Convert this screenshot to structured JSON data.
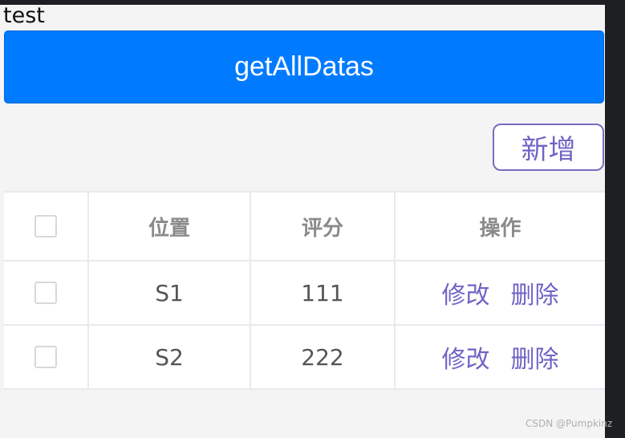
{
  "app": {
    "title": "test",
    "main_button_label": "getAllDatas",
    "add_button_label": "新增"
  },
  "table": {
    "columns": [
      "位置",
      "评分",
      "操作"
    ],
    "rows": [
      {
        "position": "S1",
        "score": "111",
        "edit": "修改",
        "delete": "删除"
      },
      {
        "position": "S2",
        "score": "222",
        "edit": "修改",
        "delete": "删除"
      }
    ]
  },
  "watermark": "CSDN @Pumpkinz",
  "colors": {
    "primary": "#007bff",
    "accent_purple": "#6f64c6",
    "background": "#f4f4f5"
  }
}
